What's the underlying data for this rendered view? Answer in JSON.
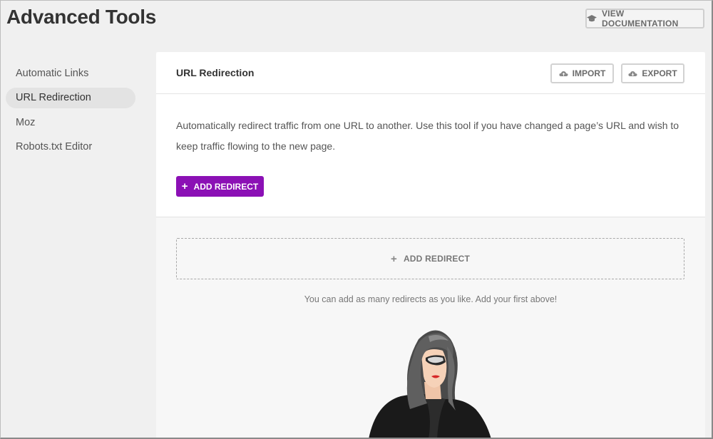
{
  "page": {
    "title": "Advanced Tools"
  },
  "header": {
    "doc_button": "VIEW DOCUMENTATION",
    "doc_icon": "graduation-cap-icon"
  },
  "sidebar": {
    "items": [
      {
        "label": "Automatic Links",
        "active": false
      },
      {
        "label": "URL Redirection",
        "active": true
      },
      {
        "label": "Moz",
        "active": false
      },
      {
        "label": "Robots.txt Editor",
        "active": false
      }
    ]
  },
  "panel": {
    "title": "URL Redirection",
    "import_label": "IMPORT",
    "export_label": "EXPORT",
    "description": "Automatically redirect traffic from one URL to another. Use this tool if you have changed a page’s URL and wish to keep traffic flowing to the new page.",
    "add_button": "ADD REDIRECT",
    "dashed_add": "ADD REDIRECT",
    "empty_message": "You can add as many redirects as you like. Add your first above!"
  },
  "colors": {
    "accent": "#8b10b5",
    "background": "#f0f0f0"
  }
}
